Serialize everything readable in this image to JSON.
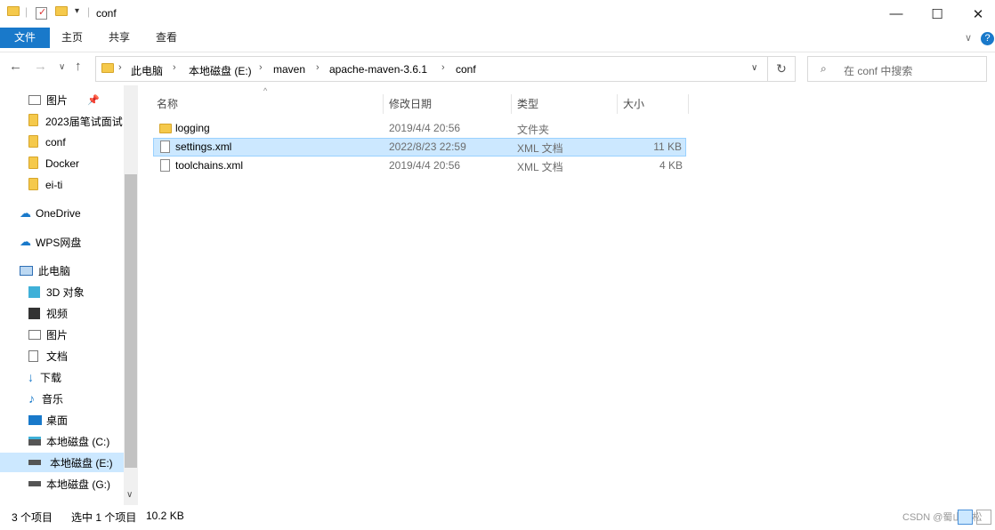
{
  "window": {
    "title": "conf"
  },
  "ribbon": {
    "tabs": [
      "文件",
      "主页",
      "共享",
      "查看"
    ]
  },
  "address": {
    "crumbs": [
      "此电脑",
      "本地磁盘 (E:)",
      "maven",
      "apache-maven-3.6.1",
      "conf"
    ]
  },
  "search": {
    "placeholder": "在 conf 中搜索"
  },
  "sidebar": {
    "quick": [
      "图片",
      "2023届笔试面试",
      "conf",
      "Docker",
      "ei-ti"
    ],
    "onedrive": "OneDrive",
    "wps": "WPS网盘",
    "pc": "此电脑",
    "pc_items": [
      "3D 对象",
      "视频",
      "图片",
      "文档",
      "下载",
      "音乐",
      "桌面",
      "本地磁盘 (C:)",
      "本地磁盘 (E:)",
      "本地磁盘 (G:)"
    ]
  },
  "columns": [
    "名称",
    "修改日期",
    "类型",
    "大小"
  ],
  "files": [
    {
      "name": "logging",
      "date": "2019/4/4 20:56",
      "type": "文件夹",
      "size": ""
    },
    {
      "name": "settings.xml",
      "date": "2022/8/23 22:59",
      "type": "XML 文档",
      "size": "11 KB"
    },
    {
      "name": "toolchains.xml",
      "date": "2019/4/4 20:56",
      "type": "XML 文档",
      "size": "4 KB"
    }
  ],
  "status": {
    "count": "3 个项目",
    "selected": "选中 1 个项目",
    "size": "10.2 KB"
  },
  "watermark": "CSDN @蜀山雪松"
}
